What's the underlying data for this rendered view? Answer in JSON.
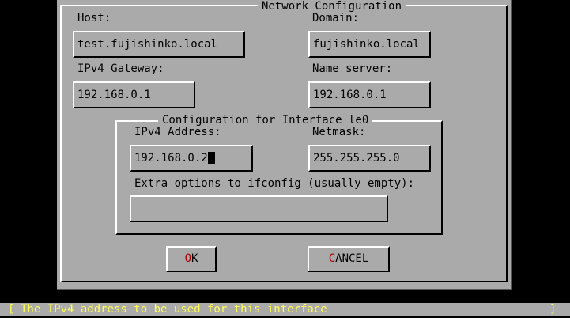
{
  "dialog": {
    "title": "Network Configuration",
    "host_label": "Host:",
    "host_value": "test.fujishinko.local",
    "domain_label": "Domain:",
    "domain_value": "fujishinko.local",
    "gateway_label": "IPv4 Gateway:",
    "gateway_value": "192.168.0.1",
    "nameserver_label": "Name server:",
    "nameserver_value": "192.168.0.1"
  },
  "interface": {
    "title": "Configuration for Interface le0",
    "ipv4_label": "IPv4 Address:",
    "ipv4_value": "192.168.0.2",
    "netmask_label": "Netmask:",
    "netmask_value": "255.255.255.0",
    "extra_label": "Extra options to ifconfig (usually empty):",
    "extra_value": ""
  },
  "buttons": {
    "ok_hotkey": "O",
    "ok_rest": "K",
    "cancel_hotkey": "C",
    "cancel_rest": "ANCEL"
  },
  "status": {
    "left_bracket": "[",
    "message": "The IPv4 address to be used for this interface",
    "right_bracket": "]"
  },
  "colors": {
    "background": "#000000",
    "dialog": "#aaaaaa",
    "hotkey": "#aa0000",
    "status_text": "#ffff55"
  }
}
